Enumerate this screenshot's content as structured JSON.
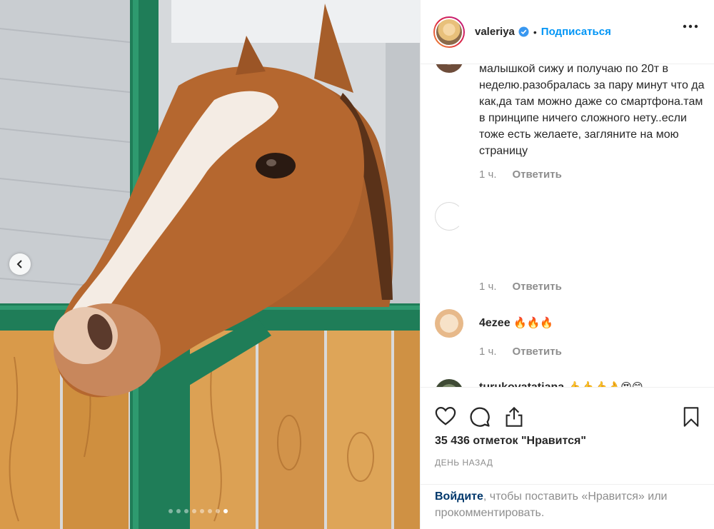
{
  "header": {
    "username": "valeriya",
    "separator": "•",
    "follow_label": "Подписаться"
  },
  "comments": [
    {
      "text": "малышкой сижу и получаю по 20т в неделю.разобралась за пару минут что да как,да там можно даже со смартфона.там в принципе ничего сложного нету..если тоже есть желаете, загляните на мою страницу",
      "time": "1 ч.",
      "reply": "Ответить"
    },
    {
      "text": "",
      "time": "1 ч.",
      "reply": "Ответить"
    },
    {
      "user": "4ezee",
      "emoji": "🔥🔥🔥",
      "time": "1 ч.",
      "reply": "Ответить"
    },
    {
      "user": "turukovatatiana",
      "emoji": "👍👍👍👌😍😊"
    }
  ],
  "actions": {
    "likes": "35 436 отметок \"Нравится\"",
    "time": "ДЕНЬ НАЗАД",
    "icons": [
      "heart-icon",
      "comment-icon",
      "share-icon",
      "bookmark-icon"
    ]
  },
  "login": {
    "link": "Войдите",
    "rest": ", чтобы поставить «Нравится» или прокомментировать."
  },
  "carousel": {
    "total": 8,
    "active": 7
  },
  "colors": {
    "accent": "#0095f6",
    "text": "#262626",
    "muted": "#8e8e8e"
  }
}
